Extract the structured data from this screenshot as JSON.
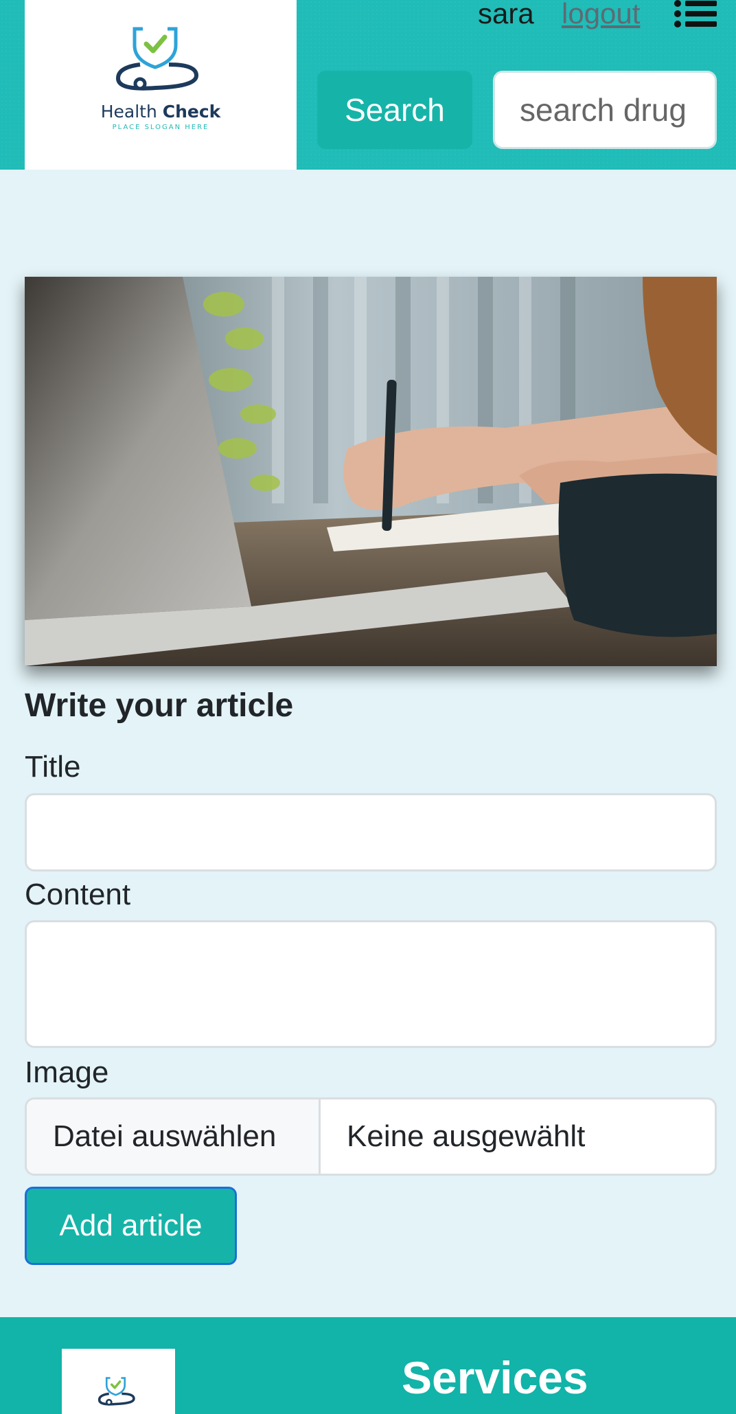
{
  "header": {
    "logo": {
      "brand_regular": "Health ",
      "brand_bold": "Check",
      "slogan": "PLACE SLOGAN HERE"
    },
    "user_name": "sara",
    "logout_label": "logout",
    "search_button_label": "Search",
    "search_placeholder": "search drug"
  },
  "article_form": {
    "heading": "Write your article",
    "title_label": "Title",
    "title_value": "",
    "content_label": "Content",
    "content_value": "",
    "image_label": "Image",
    "file_button_label": "Datei auswählen",
    "file_status": "Keine ausgewählt",
    "submit_label": "Add article"
  },
  "footer": {
    "services_title": "Services"
  },
  "colors": {
    "header_bg": "#1fbcb8",
    "button_bg": "#16b4a8",
    "page_bg": "#e3f3f7",
    "footer_bg": "#12b3a8"
  }
}
